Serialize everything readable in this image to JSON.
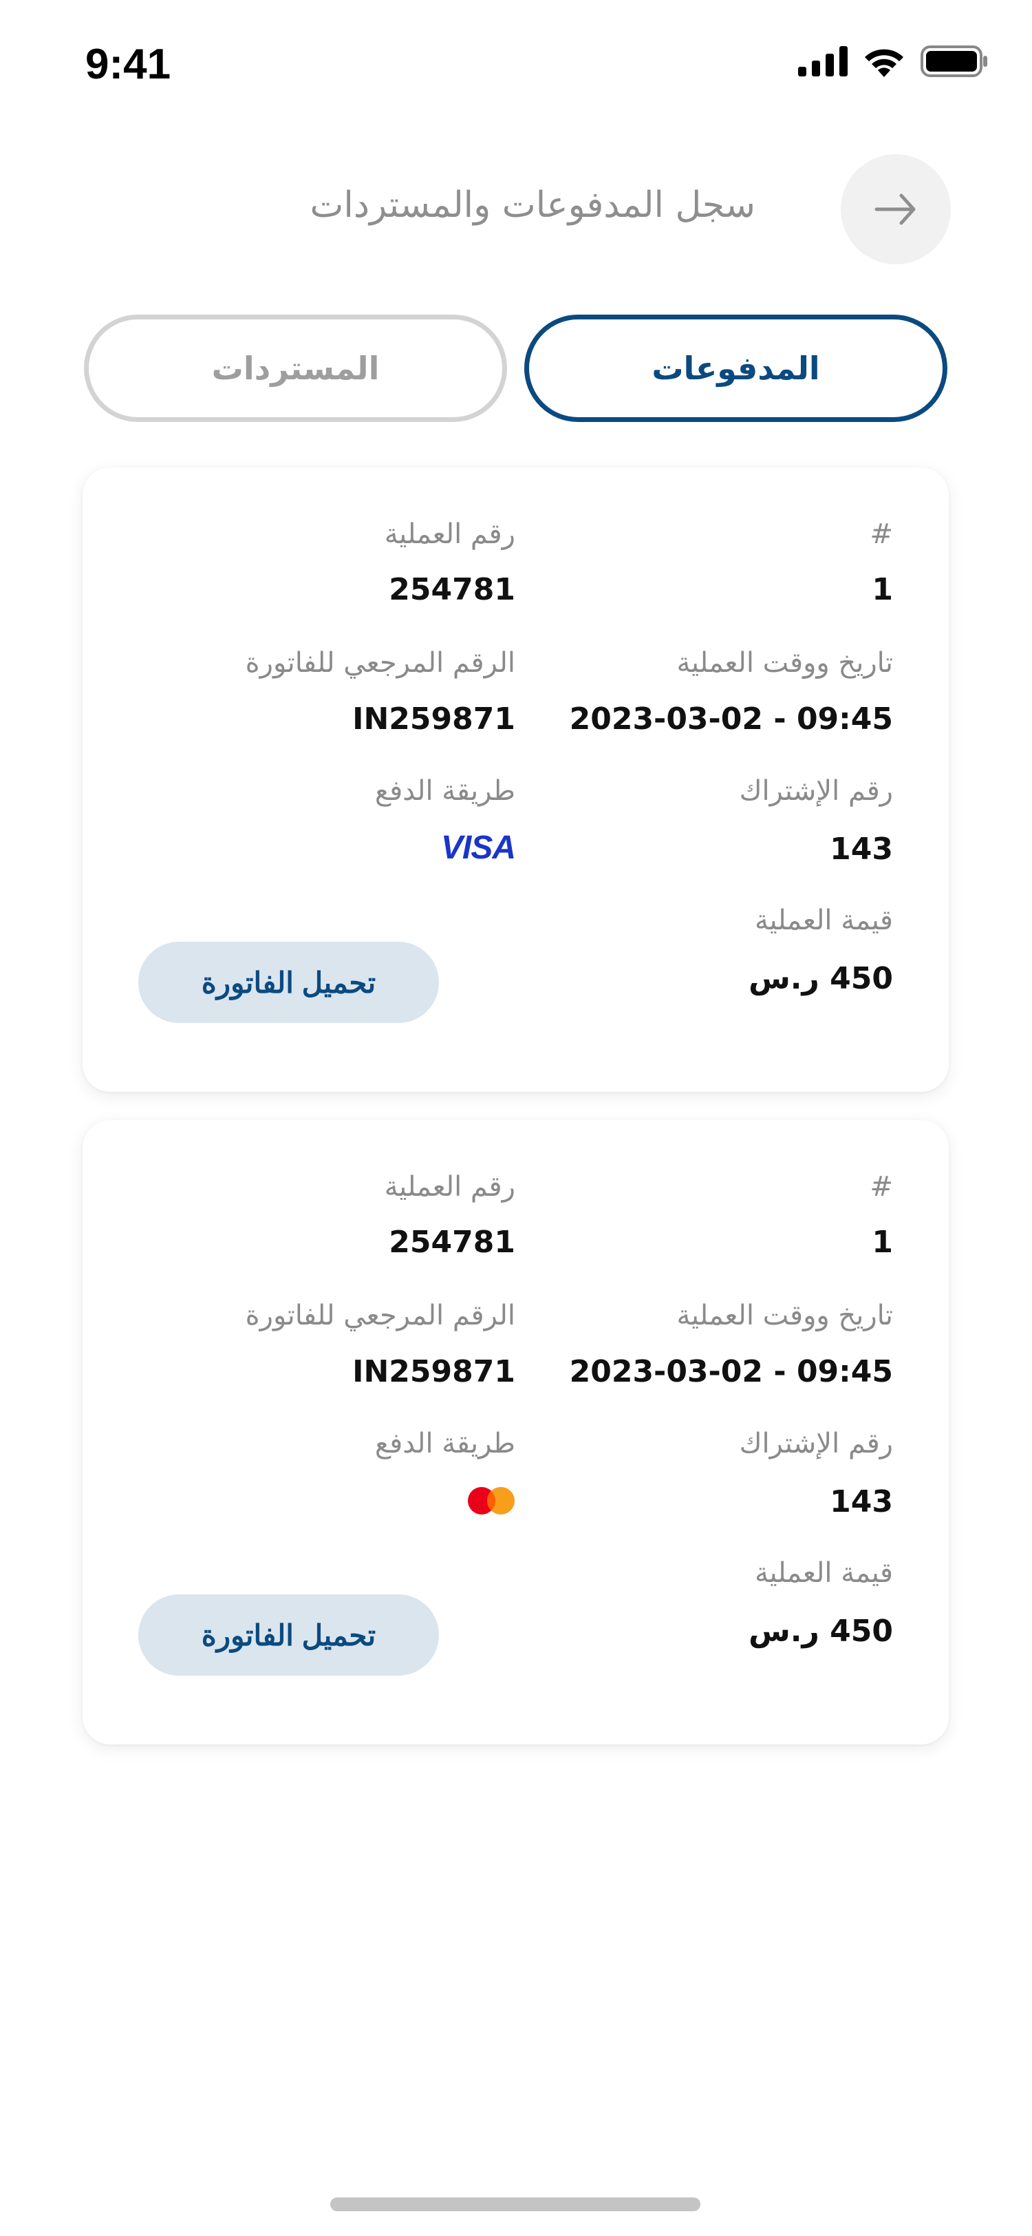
{
  "status_bar": {
    "time": "9:41"
  },
  "header": {
    "title": "سجل المدفوعات والمستردات",
    "back_icon": "arrow-right-icon"
  },
  "tabs": [
    {
      "label": "المدفوعات",
      "active": true
    },
    {
      "label": "المستردات",
      "active": false
    }
  ],
  "colors": {
    "accent": "#0b4a80",
    "button_bg": "#dae5ee",
    "visa": "#1a35c9"
  },
  "cards": [
    {
      "index_label": "#",
      "index_value": "1",
      "txn_no_label": "رقم العملية",
      "txn_no_value": "254781",
      "datetime_label": "تاريخ ووقت العملية",
      "datetime_value": "2023-03-02 - 09:45",
      "invoice_ref_label": "الرقم المرجعي للفاتورة",
      "invoice_ref_value": "IN259871",
      "subscription_label": "رقم الإشتراك",
      "subscription_value": "143",
      "payment_method_label": "طريقة الدفع",
      "payment_method": "VISA",
      "amount_label": "قيمة العملية",
      "amount_value": "450 ر.س",
      "download_label": "تحميل الفاتورة"
    },
    {
      "index_label": "#",
      "index_value": "1",
      "txn_no_label": "رقم العملية",
      "txn_no_value": "254781",
      "datetime_label": "تاريخ ووقت العملية",
      "datetime_value": "2023-03-02 - 09:45",
      "invoice_ref_label": "الرقم المرجعي للفاتورة",
      "invoice_ref_value": "IN259871",
      "subscription_label": "رقم الإشتراك",
      "subscription_value": "143",
      "payment_method_label": "طريقة الدفع",
      "payment_method": "mastercard",
      "amount_label": "قيمة العملية",
      "amount_value": "450 ر.س",
      "download_label": "تحميل الفاتورة"
    }
  ]
}
